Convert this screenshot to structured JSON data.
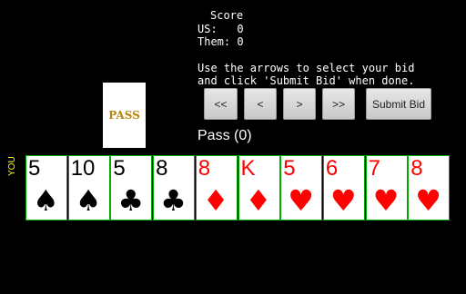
{
  "score": {
    "title": "Score",
    "us_label": "US:",
    "us_value": "0",
    "them_label": "Them:",
    "them_value": "0"
  },
  "instructions": {
    "line1": "Use the arrows to select your bid",
    "line2": "and click 'Submit Bid' when done."
  },
  "pass_card": {
    "label": "PASS"
  },
  "buttons": {
    "first": "<<",
    "prev": "<",
    "next": ">",
    "last": ">>",
    "submit": "Submit Bid"
  },
  "bid_status": "Pass (0)",
  "player_label": "YOU",
  "colors": {
    "black_suit": "#000000",
    "red_suit": "#ff0000",
    "card_border": "#00aa00",
    "pass_text": "#b8860b"
  },
  "hand": [
    {
      "rank": "5",
      "suit": "♠",
      "suit_name": "spade-icon",
      "color": "black"
    },
    {
      "rank": "10",
      "suit": "♠",
      "suit_name": "spade-icon",
      "color": "black"
    },
    {
      "rank": "5",
      "suit": "♣",
      "suit_name": "club-icon",
      "color": "black"
    },
    {
      "rank": "8",
      "suit": "♣",
      "suit_name": "club-icon",
      "color": "black"
    },
    {
      "rank": "8",
      "suit": "♦",
      "suit_name": "diamond-icon",
      "color": "red"
    },
    {
      "rank": "K",
      "suit": "♦",
      "suit_name": "diamond-icon",
      "color": "red"
    },
    {
      "rank": "5",
      "suit": "♥",
      "suit_name": "heart-icon",
      "color": "red"
    },
    {
      "rank": "6",
      "suit": "♥",
      "suit_name": "heart-icon",
      "color": "red"
    },
    {
      "rank": "7",
      "suit": "♥",
      "suit_name": "heart-icon",
      "color": "red"
    },
    {
      "rank": "8",
      "suit": "♥",
      "suit_name": "heart-icon",
      "color": "red"
    }
  ]
}
